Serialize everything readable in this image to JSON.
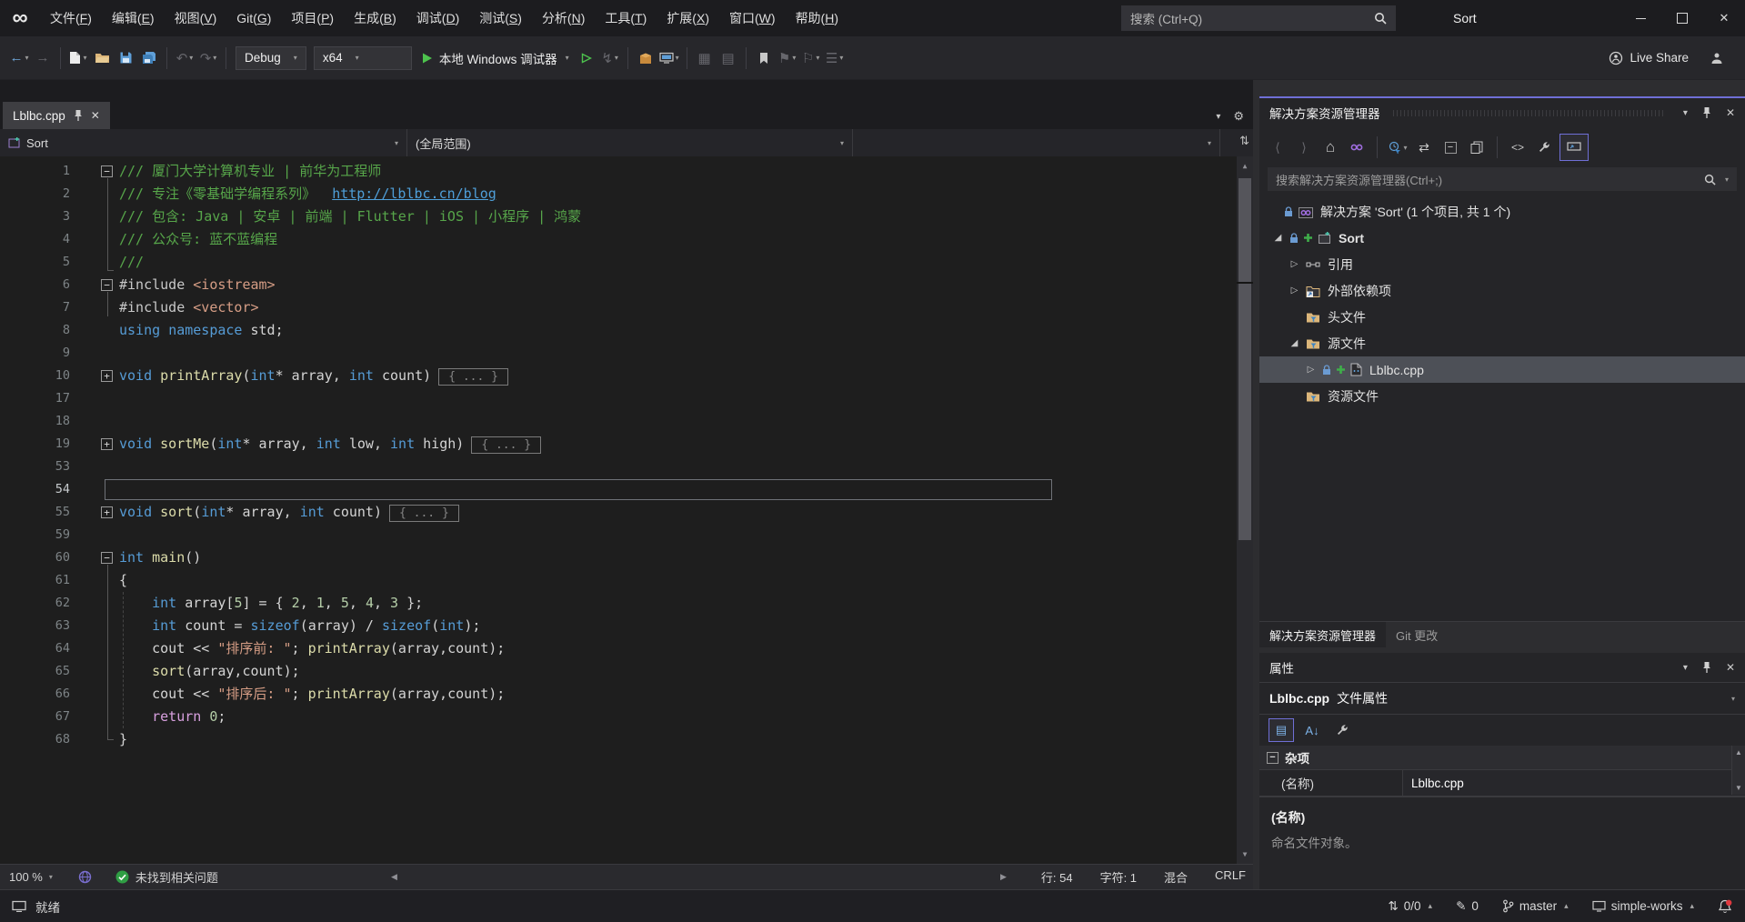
{
  "colors": {
    "accent": "#6f6fd6",
    "cm": "#57a64a",
    "kw": "#569cd6",
    "st": "#d69d85",
    "nu": "#b5cea8",
    "fn": "#dcdcaa",
    "ctl": "#d8a0df",
    "lk": "#4f9fd9",
    "pp": "#c8c8c8",
    "tx": "#d4d4d4",
    "run": "#4dc24d",
    "check": "#2f9e44",
    "folder": "#dcb67a",
    "lock": "#6b9bd2",
    "error": "#e0393f"
  },
  "titlebar": {
    "title": "Sort",
    "search_placeholder": "搜索 (Ctrl+Q)",
    "menus": [
      "文件(F)",
      "编辑(E)",
      "视图(V)",
      "Git(G)",
      "项目(P)",
      "生成(B)",
      "调试(D)",
      "测试(S)",
      "分析(N)",
      "工具(T)",
      "扩展(X)",
      "窗口(W)",
      "帮助(H)"
    ]
  },
  "toolbar": {
    "debug_config": "Debug",
    "platform": "x64",
    "run_label": "本地 Windows 调试器",
    "live_share": "Live Share"
  },
  "editor": {
    "tab": "Lblbc.cpp",
    "nav_scope": "Sort",
    "nav_context": "(全局范围)",
    "collapsed_label": "{ ... }",
    "statusbar": {
      "zoom": "100 %",
      "issues": "未找到相关问题",
      "line_label": "行: 54",
      "char_label": "字符: 1",
      "mixed": "混合",
      "eol": "CRLF"
    },
    "lines": [
      {
        "n": 1,
        "g": "-",
        "s": [
          [
            "/// 厦门大学计算机专业 | 前华为工程师",
            "cm"
          ]
        ]
      },
      {
        "n": 2,
        "s": [
          [
            "/// 专注《零基础学编程系列》  ",
            "cm"
          ],
          [
            "http://lblbc.cn/blog",
            "lk"
          ]
        ]
      },
      {
        "n": 3,
        "s": [
          [
            "/// 包含: Java | 安卓 | 前端 | Flutter | iOS | 小程序 | 鸿蒙",
            "cm"
          ]
        ]
      },
      {
        "n": 4,
        "s": [
          [
            "/// 公众号: 蓝不蓝编程",
            "cm"
          ]
        ]
      },
      {
        "n": 5,
        "s": [
          [
            "///",
            "cm"
          ]
        ]
      },
      {
        "n": 6,
        "g": "-",
        "s": [
          [
            "#include ",
            "pp"
          ],
          [
            "<iostream>",
            "st"
          ]
        ]
      },
      {
        "n": 7,
        "s": [
          [
            "#include ",
            "pp"
          ],
          [
            "<vector>",
            "st"
          ]
        ]
      },
      {
        "n": 8,
        "s": [
          [
            "using",
            "kw"
          ],
          [
            " ",
            "tx"
          ],
          [
            "namespace",
            "kw"
          ],
          [
            " std;",
            "tx"
          ]
        ]
      },
      {
        "n": 9,
        "s": []
      },
      {
        "n": 10,
        "g": "+",
        "fold": true,
        "s": [
          [
            "void",
            "kw"
          ],
          [
            " ",
            "tx"
          ],
          [
            "printArray",
            "fn"
          ],
          [
            "(",
            "tx"
          ],
          [
            "int",
            "kw"
          ],
          [
            "* array, ",
            "tx"
          ],
          [
            "int",
            "kw"
          ],
          [
            " count)",
            "tx"
          ]
        ]
      },
      {
        "n": 17,
        "s": []
      },
      {
        "n": 18,
        "s": []
      },
      {
        "n": 19,
        "g": "+",
        "fold": true,
        "s": [
          [
            "void",
            "kw"
          ],
          [
            " ",
            "tx"
          ],
          [
            "sortMe",
            "fn"
          ],
          [
            "(",
            "tx"
          ],
          [
            "int",
            "kw"
          ],
          [
            "* array, ",
            "tx"
          ],
          [
            "int",
            "kw"
          ],
          [
            " low, ",
            "tx"
          ],
          [
            "int",
            "kw"
          ],
          [
            " high)",
            "tx"
          ]
        ]
      },
      {
        "n": 53,
        "s": []
      },
      {
        "n": 54,
        "cur": true,
        "s": []
      },
      {
        "n": 55,
        "g": "+",
        "fold": true,
        "s": [
          [
            "void",
            "kw"
          ],
          [
            " ",
            "tx"
          ],
          [
            "sort",
            "fn"
          ],
          [
            "(",
            "tx"
          ],
          [
            "int",
            "kw"
          ],
          [
            "* array, ",
            "tx"
          ],
          [
            "int",
            "kw"
          ],
          [
            " count)",
            "tx"
          ]
        ]
      },
      {
        "n": 59,
        "s": []
      },
      {
        "n": 60,
        "g": "-",
        "s": [
          [
            "int",
            "kw"
          ],
          [
            " ",
            "tx"
          ],
          [
            "main",
            "fn"
          ],
          [
            "()",
            "tx"
          ]
        ]
      },
      {
        "n": 61,
        "s": [
          [
            "{",
            "tx"
          ]
        ]
      },
      {
        "n": 62,
        "s": [
          [
            "    ",
            "tx"
          ],
          [
            "int",
            "kw"
          ],
          [
            " array[",
            "tx"
          ],
          [
            "5",
            "nu"
          ],
          [
            "] = { ",
            "tx"
          ],
          [
            "2",
            "nu"
          ],
          [
            ", ",
            "tx"
          ],
          [
            "1",
            "nu"
          ],
          [
            ", ",
            "tx"
          ],
          [
            "5",
            "nu"
          ],
          [
            ", ",
            "tx"
          ],
          [
            "4",
            "nu"
          ],
          [
            ", ",
            "tx"
          ],
          [
            "3",
            "nu"
          ],
          [
            " };",
            "tx"
          ]
        ]
      },
      {
        "n": 63,
        "s": [
          [
            "    ",
            "tx"
          ],
          [
            "int",
            "kw"
          ],
          [
            " count = ",
            "tx"
          ],
          [
            "sizeof",
            "kw"
          ],
          [
            "(array) / ",
            "tx"
          ],
          [
            "sizeof",
            "kw"
          ],
          [
            "(",
            "tx"
          ],
          [
            "int",
            "kw"
          ],
          [
            ");",
            "tx"
          ]
        ]
      },
      {
        "n": 64,
        "s": [
          [
            "    cout << ",
            "tx"
          ],
          [
            "\"排序前: \"",
            "st"
          ],
          [
            "; ",
            "tx"
          ],
          [
            "printArray",
            "fn"
          ],
          [
            "(array,count);",
            "tx"
          ]
        ]
      },
      {
        "n": 65,
        "s": [
          [
            "    ",
            "tx"
          ],
          [
            "sort",
            "fn"
          ],
          [
            "(array,count);",
            "tx"
          ]
        ]
      },
      {
        "n": 66,
        "s": [
          [
            "    cout << ",
            "tx"
          ],
          [
            "\"排序后: \"",
            "st"
          ],
          [
            "; ",
            "tx"
          ],
          [
            "printArray",
            "fn"
          ],
          [
            "(array,count);",
            "tx"
          ]
        ]
      },
      {
        "n": 67,
        "s": [
          [
            "    ",
            "tx"
          ],
          [
            "return",
            "ctl"
          ],
          [
            " ",
            "tx"
          ],
          [
            "0",
            "nu"
          ],
          [
            ";",
            "tx"
          ]
        ]
      },
      {
        "n": 68,
        "s": [
          [
            "}",
            "tx"
          ]
        ]
      }
    ]
  },
  "solution_explorer": {
    "title": "解决方案资源管理器",
    "search_placeholder": "搜索解决方案资源管理器(Ctrl+;)",
    "tree": [
      {
        "label": "解决方案 'Sort' (1 个项目, 共 1 个)",
        "icon": "solution",
        "lock": true,
        "indent": 0,
        "expand": null
      },
      {
        "label": "Sort",
        "icon": "project",
        "lock": true,
        "plus": true,
        "indent": 1,
        "expand": "open",
        "bold": true
      },
      {
        "label": "引用",
        "icon": "references",
        "indent": 2,
        "expand": "closed"
      },
      {
        "label": "外部依赖项",
        "icon": "extdeps",
        "indent": 2,
        "expand": "closed"
      },
      {
        "label": "头文件",
        "icon": "folderfilter",
        "indent": 2,
        "expand": null
      },
      {
        "label": "源文件",
        "icon": "folderfilter",
        "indent": 2,
        "expand": "open"
      },
      {
        "label": "Lblbc.cpp",
        "icon": "cppfile",
        "lock": true,
        "plus": true,
        "indent": 3,
        "expand": "closed",
        "selected": true
      },
      {
        "label": "资源文件",
        "icon": "folderfilter",
        "indent": 2,
        "expand": null
      }
    ],
    "tabs": [
      "解决方案资源管理器",
      "Git 更改"
    ]
  },
  "properties": {
    "title": "属性",
    "object_name": "Lblbc.cpp",
    "object_suffix": "文件属性",
    "group": "杂项",
    "rows": [
      {
        "name": "(名称)",
        "value": "Lblbc.cpp"
      }
    ],
    "description_title": "(名称)",
    "description": "命名文件对象。"
  },
  "statusbar": {
    "ready": "就绪",
    "sync": "0/0",
    "edits": "0",
    "branch": "master",
    "machine": "simple-works"
  }
}
